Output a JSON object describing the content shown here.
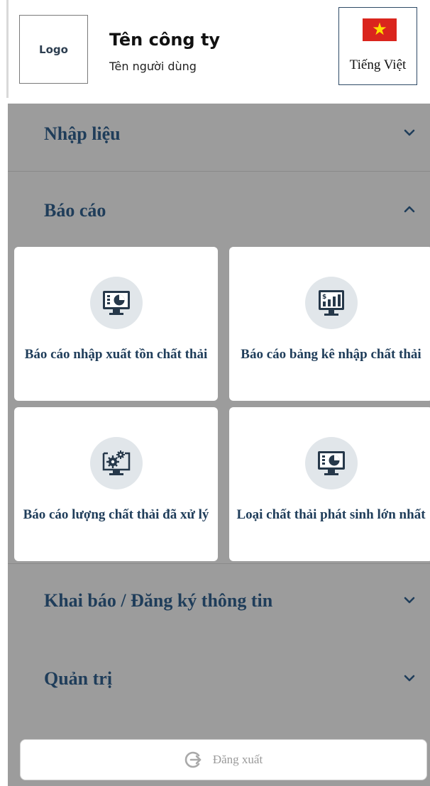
{
  "header": {
    "logo": "Logo",
    "company_name": "Tên công ty",
    "user_name": "Tên người dùng",
    "language": {
      "label": "Tiếng Việt",
      "flag_icon": "vietnam-flag-icon"
    }
  },
  "menu": {
    "sections": [
      {
        "label": "Nhập liệu",
        "state": "collapsed"
      },
      {
        "label": "Báo cáo",
        "state": "expanded"
      },
      {
        "label": "Khai báo / Đăng ký thông tin",
        "state": "collapsed"
      },
      {
        "label": "Quản trị",
        "state": "collapsed"
      }
    ],
    "report_cards": [
      {
        "label": "Báo cáo nhập xuất tồn chất thải",
        "icon": "monitor-pie-chart-icon"
      },
      {
        "label": "Báo cáo bảng kê nhập chất thải",
        "icon": "monitor-bar-chart-dollar-icon"
      },
      {
        "label": "Báo cáo lượng chất thải đã xử lý",
        "icon": "monitor-gears-icon"
      },
      {
        "label": "Loại chất thải phát sinh lớn nhất",
        "icon": "monitor-pie-chart-icon"
      }
    ]
  },
  "logout": {
    "label": "Đăng xuất",
    "icon": "logout-icon"
  },
  "colors": {
    "menu_background": "#9c9c9c",
    "heading_text": "#1f3d5a",
    "icon_circle": "#e1e6ea",
    "icon_dark": "#26384a",
    "flag_red": "#da251d",
    "flag_star": "#ffde00"
  }
}
